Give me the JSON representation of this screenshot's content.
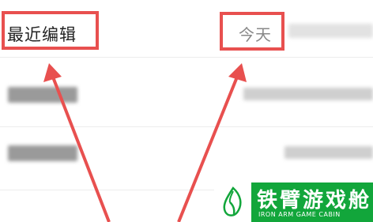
{
  "header": {
    "recent_label": "最近编辑",
    "today_label": "今天"
  },
  "watermark": {
    "title": "铁臂游戏舱",
    "subtitle": "IRON ARM GAME CABIN"
  },
  "colors": {
    "highlight": "#e8504f",
    "watermark_bg": "#12a63b"
  },
  "icons": [
    "arrow-icon",
    "watermark-logo-icon"
  ]
}
